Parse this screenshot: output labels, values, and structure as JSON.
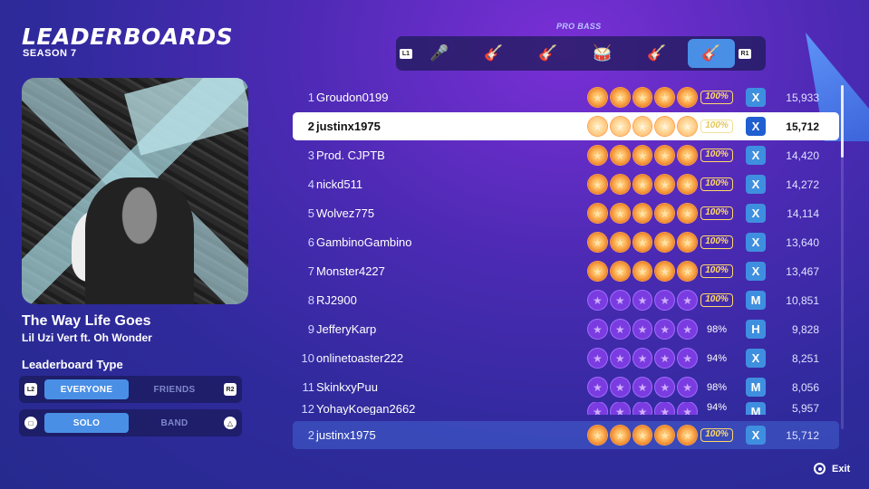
{
  "header": {
    "title": "LEADERBOARDS",
    "season": "SEASON 7"
  },
  "song": {
    "title": "The Way Life Goes",
    "artist": "Lil Uzi Vert ft. Oh Wonder"
  },
  "leaderboard_type": {
    "label": "Leaderboard Type",
    "scope": {
      "left_button": "L2",
      "right_button": "R2",
      "options": [
        "EVERYONE",
        "FRIENDS"
      ],
      "selected": "EVERYONE"
    },
    "mode": {
      "left_button": "□",
      "right_button": "△",
      "options": [
        "SOLO",
        "BAND"
      ],
      "selected": "SOLO"
    }
  },
  "instruments": {
    "label": "PRO BASS",
    "left_button": "L1",
    "right_button": "R1",
    "items": [
      {
        "icon": "microphone-icon",
        "glyph": "🎤"
      },
      {
        "icon": "guitar-icon",
        "glyph": "🎸"
      },
      {
        "icon": "bass-icon",
        "glyph": "🎸"
      },
      {
        "icon": "drums-icon",
        "glyph": "🥁"
      },
      {
        "icon": "pro-guitar-icon",
        "glyph": "🎸"
      },
      {
        "icon": "pro-bass-icon",
        "glyph": "🎸"
      }
    ],
    "selected_index": 5
  },
  "rows": [
    {
      "rank": "1",
      "name": "Groudon0199",
      "stars": "gold",
      "pct": "100%",
      "full": true,
      "diff": "X",
      "score": "15,933"
    },
    {
      "rank": "2",
      "name": "justinx1975",
      "stars": "gold",
      "pct": "100%",
      "full": true,
      "diff": "X",
      "score": "15,712",
      "highlight": true
    },
    {
      "rank": "3",
      "name": "Prod. CJPTB",
      "stars": "gold",
      "pct": "100%",
      "full": true,
      "diff": "X",
      "score": "14,420"
    },
    {
      "rank": "4",
      "name": "nickd511",
      "stars": "gold",
      "pct": "100%",
      "full": true,
      "diff": "X",
      "score": "14,272"
    },
    {
      "rank": "5",
      "name": "Wolvez775",
      "stars": "gold",
      "pct": "100%",
      "full": true,
      "diff": "X",
      "score": "14,114"
    },
    {
      "rank": "6",
      "name": "GambinoGambino",
      "stars": "gold",
      "pct": "100%",
      "full": true,
      "diff": "X",
      "score": "13,640"
    },
    {
      "rank": "7",
      "name": "Monster4227",
      "stars": "gold",
      "pct": "100%",
      "full": true,
      "diff": "X",
      "score": "13,467"
    },
    {
      "rank": "8",
      "name": "RJ2900",
      "stars": "purple",
      "pct": "100%",
      "full": true,
      "diff": "M",
      "score": "10,851"
    },
    {
      "rank": "9",
      "name": "JefferyKarp",
      "stars": "purple",
      "pct": "98%",
      "full": false,
      "diff": "H",
      "score": "9,828"
    },
    {
      "rank": "10",
      "name": "onlinetoaster222",
      "stars": "purple",
      "pct": "94%",
      "full": false,
      "diff": "X",
      "score": "8,251"
    },
    {
      "rank": "11",
      "name": "SkinkxyPuu",
      "stars": "purple",
      "pct": "98%",
      "full": false,
      "diff": "M",
      "score": "8,056"
    },
    {
      "rank": "12",
      "name": "YohayKoegan2662",
      "stars": "purple",
      "pct": "94%",
      "full": false,
      "diff": "M",
      "score": "5,957"
    }
  ],
  "player_row": {
    "rank": "2",
    "name": "justinx1975",
    "stars": "gold",
    "pct": "100%",
    "full": true,
    "diff": "X",
    "score": "15,712"
  },
  "footer": {
    "exit_label": "Exit"
  },
  "colors": {
    "accent": "#4a8fe6",
    "gold": "#f08a2a",
    "purple": "#7a3ce0"
  }
}
